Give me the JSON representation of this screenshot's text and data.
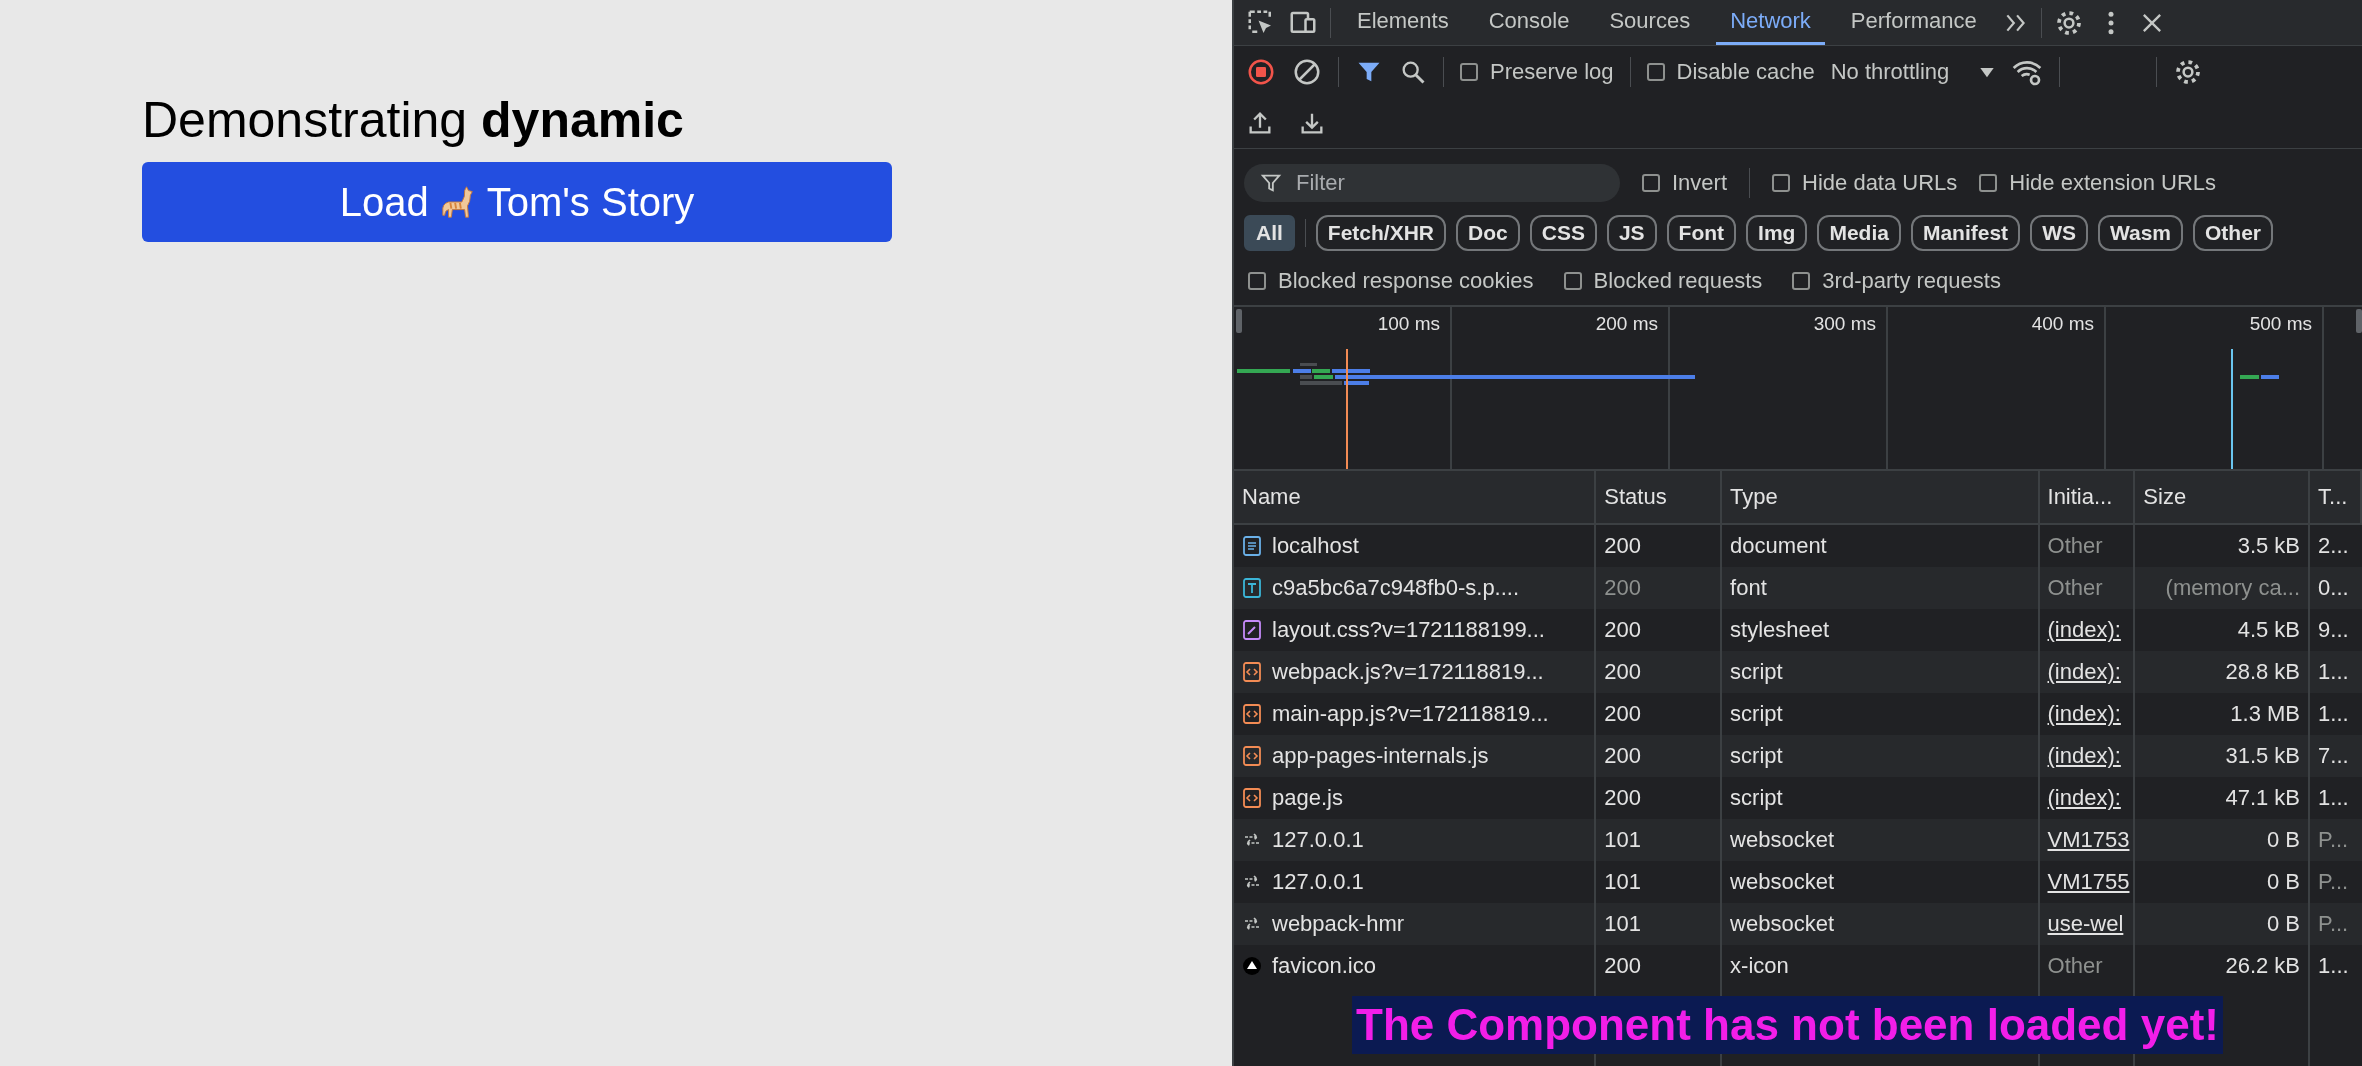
{
  "page": {
    "heading": "Demonstrating **dynamic**",
    "button": {
      "label_start": "Load",
      "label_end": "Tom's Story"
    }
  },
  "devtools": {
    "tabs": [
      {
        "label": "Elements",
        "selected": false
      },
      {
        "label": "Console",
        "selected": false
      },
      {
        "label": "Sources",
        "selected": false
      },
      {
        "label": "Network",
        "selected": true
      },
      {
        "label": "Performance",
        "selected": false
      }
    ],
    "toolbar": {
      "preserve_log": {
        "label": "Preserve log",
        "checked": false
      },
      "disable_cache": {
        "label": "Disable cache",
        "checked": false
      },
      "throttling": "No throttling"
    },
    "filter": {
      "placeholder": "Filter",
      "options": [
        {
          "label": "Invert",
          "checked": false
        },
        {
          "label": "Hide data URLs",
          "checked": false
        },
        {
          "label": "Hide extension URLs",
          "checked": false
        }
      ]
    },
    "type_filters": [
      {
        "label": "All",
        "selected": true
      },
      {
        "label": "Fetch/XHR",
        "selected": false
      },
      {
        "label": "Doc",
        "selected": false
      },
      {
        "label": "CSS",
        "selected": false
      },
      {
        "label": "JS",
        "selected": false
      },
      {
        "label": "Font",
        "selected": false
      },
      {
        "label": "Img",
        "selected": false
      },
      {
        "label": "Media",
        "selected": false
      },
      {
        "label": "Manifest",
        "selected": false
      },
      {
        "label": "WS",
        "selected": false
      },
      {
        "label": "Wasm",
        "selected": false
      },
      {
        "label": "Other",
        "selected": false
      }
    ],
    "blocked_options": [
      {
        "label": "Blocked response cookies",
        "checked": false
      },
      {
        "label": "Blocked requests",
        "checked": false
      },
      {
        "label": "3rd-party requests",
        "checked": false
      }
    ],
    "timeline_ticks": [
      "100 ms",
      "200 ms",
      "300 ms",
      "400 ms",
      "500 ms"
    ],
    "table": {
      "columns": [
        "Name",
        "Status",
        "Type",
        "Initia...",
        "Size",
        "T..."
      ],
      "rows": [
        {
          "kind": "doc-file",
          "name": "localhost",
          "status": "200",
          "status_muted": false,
          "type": "document",
          "initiator": "Other",
          "initiator_link": false,
          "size": "3.5 kB",
          "size_muted": false,
          "time": "2...",
          "time_muted": false
        },
        {
          "kind": "font-file",
          "name": "c9a5bc6a7c948fb0-s.p....",
          "status": "200",
          "status_muted": true,
          "type": "font",
          "initiator": "Other",
          "initiator_link": false,
          "size": "(memory ca...",
          "size_muted": true,
          "time": "0...",
          "time_muted": false
        },
        {
          "kind": "css-file",
          "name": "layout.css?v=1721188199...",
          "status": "200",
          "status_muted": false,
          "type": "stylesheet",
          "initiator": "(index):",
          "initiator_link": true,
          "size": "4.5 kB",
          "size_muted": false,
          "time": "9...",
          "time_muted": false
        },
        {
          "kind": "js-file",
          "name": "webpack.js?v=172118819...",
          "status": "200",
          "status_muted": false,
          "type": "script",
          "initiator": "(index):",
          "initiator_link": true,
          "size": "28.8 kB",
          "size_muted": false,
          "time": "1...",
          "time_muted": false
        },
        {
          "kind": "js-file",
          "name": "main-app.js?v=172118819...",
          "status": "200",
          "status_muted": false,
          "type": "script",
          "initiator": "(index):",
          "initiator_link": true,
          "size": "1.3 MB",
          "size_muted": false,
          "time": "1...",
          "time_muted": false
        },
        {
          "kind": "js-file",
          "name": "app-pages-internals.js",
          "status": "200",
          "status_muted": false,
          "type": "script",
          "initiator": "(index):",
          "initiator_link": true,
          "size": "31.5 kB",
          "size_muted": false,
          "time": "7...",
          "time_muted": false
        },
        {
          "kind": "js-file",
          "name": "page.js",
          "status": "200",
          "status_muted": false,
          "type": "script",
          "initiator": "(index):",
          "initiator_link": true,
          "size": "47.1 kB",
          "size_muted": false,
          "time": "1...",
          "time_muted": false
        },
        {
          "kind": "socket",
          "name": "127.0.0.1",
          "status": "101",
          "status_muted": false,
          "type": "websocket",
          "initiator": "VM1753",
          "initiator_link": true,
          "size": "0 B",
          "size_muted": false,
          "time": "P...",
          "time_muted": true
        },
        {
          "kind": "socket",
          "name": "127.0.0.1",
          "status": "101",
          "status_muted": false,
          "type": "websocket",
          "initiator": "VM1755",
          "initiator_link": true,
          "size": "0 B",
          "size_muted": false,
          "time": "P...",
          "time_muted": true
        },
        {
          "kind": "socket",
          "name": "webpack-hmr",
          "status": "101",
          "status_muted": false,
          "type": "websocket",
          "initiator": "use-wel",
          "initiator_link": true,
          "size": "0 B",
          "size_muted": false,
          "time": "P...",
          "time_muted": true
        },
        {
          "kind": "site-icon",
          "name": "favicon.ico",
          "status": "200",
          "status_muted": false,
          "type": "x-icon",
          "initiator": "Other",
          "initiator_link": false,
          "size": "26.2 kB",
          "size_muted": false,
          "time": "1...",
          "time_muted": false
        }
      ]
    }
  },
  "caption": "The Component has not been loaded yet!"
}
